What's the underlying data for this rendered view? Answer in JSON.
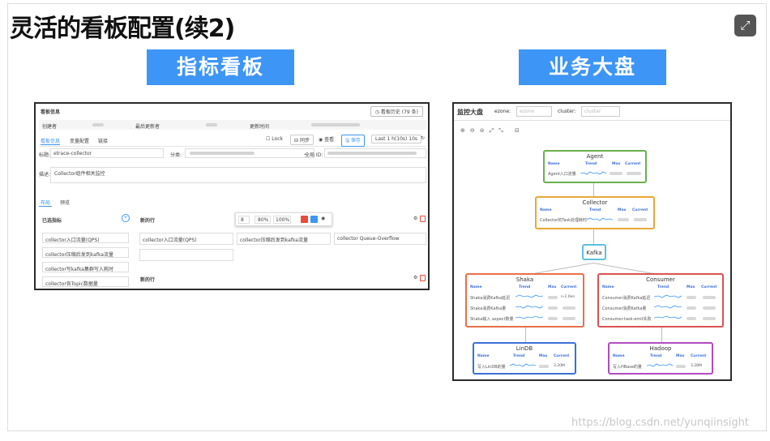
{
  "slide": {
    "title": "灵活的看板配置(续2)",
    "fullscreen_icon": "expand-icon",
    "left_label": "指标看板",
    "right_label": "业务大盘",
    "watermark": "https://blog.csdn.net/yunqiinsight"
  },
  "left_panel": {
    "header": "看板信息",
    "history_button": "看板历史 (79 条)",
    "info_labels": [
      "创建者",
      "最后更新者",
      "更新时间"
    ],
    "tabs": [
      "看板信息",
      "变量配置",
      "链接"
    ],
    "lock": "Lock",
    "sync": "同步",
    "view": "查看",
    "save": "保存",
    "time_range": "Last 1 h(10s)  10s",
    "title_label": "标题:",
    "title_value": "etrace-collector",
    "category_label": "分类:",
    "global_id_label": "全局 ID:",
    "desc_label": "描述:",
    "desc_value": "Collector组件相关监控",
    "sub_tabs": [
      "布局",
      "预览"
    ],
    "selected_metrics_title": "已选指标",
    "selected_metrics": [
      "collector入口流量(QPS)",
      "collector压缩后发到kafka流量",
      "collector写kafka集群写入耗时",
      "collector各Topic数据量"
    ],
    "new_row_label": "新的行",
    "toolbar": {
      "select": "8",
      "pct1": "80%",
      "pct2": "100%"
    },
    "row_cells": [
      "collector入口流量(QPS)",
      "collector压缩后发到kafka流量",
      "collector Queue-Overflow"
    ],
    "new_row_label2": "新的行"
  },
  "right_panel": {
    "title": "监控大盘",
    "ezone_label": "ezone:",
    "ezone_placeholder": "ezone",
    "cluster_label": "cluster:",
    "cluster_placeholder": "cluster",
    "col_headers": [
      "Name",
      "Trend",
      "Max",
      "Current"
    ],
    "nodes": {
      "agent": {
        "title": "Agent",
        "color": "#6ab04c",
        "rows": [
          "Agent入口流量"
        ]
      },
      "collector": {
        "title": "Collector",
        "color": "#e8a838",
        "rows": [
          "Collector的Task处理耗时"
        ]
      },
      "kafka": {
        "title": "Kafka",
        "color": "#5bc0de"
      },
      "shaka": {
        "title": "Shaka",
        "color": "#e8704a",
        "rows": [
          "Shaka消费Kafka延迟",
          "Shaka消费Kafka量",
          "Shaka输入 aspect数量"
        ],
        "current": "n-1.0en"
      },
      "consumer": {
        "title": "Consumer",
        "color": "#d9534f",
        "rows": [
          "Consumer消费Kafka延迟",
          "Consumer消费Kafka量",
          "Consumer-task-emit失败"
        ]
      },
      "lindb": {
        "title": "LinDB",
        "color": "#3d6fd8",
        "rows": [
          "写入LinDB的量"
        ],
        "current": "3.20M"
      },
      "hadoop": {
        "title": "Hadoop",
        "color": "#b04cc0",
        "rows": [
          "写入HBase的量"
        ],
        "current": "3.28M"
      }
    }
  }
}
